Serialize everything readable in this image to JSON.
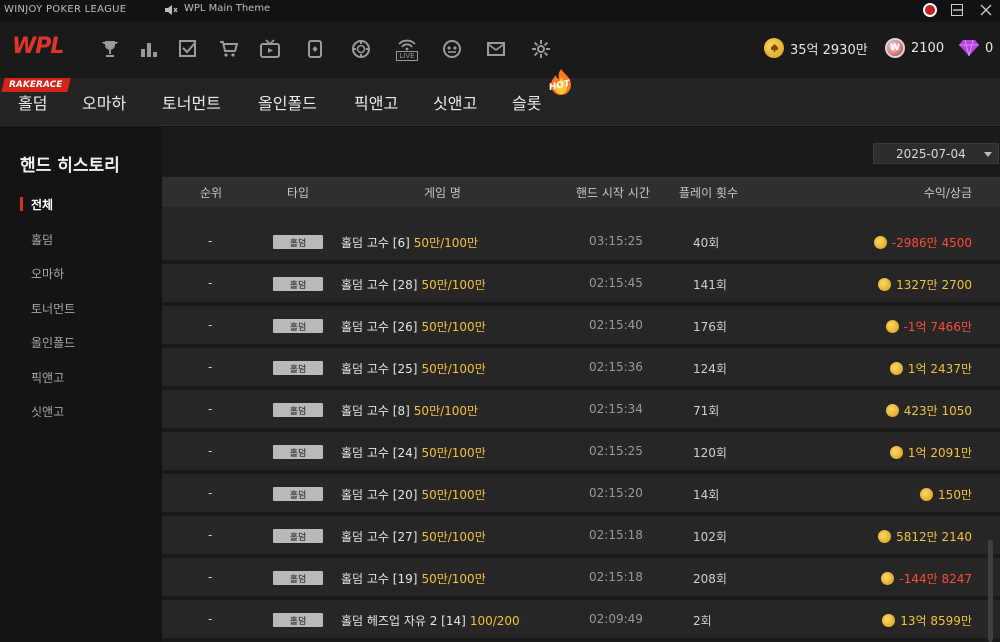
{
  "window": {
    "app_title": "WINJOY POKER LEAGUE",
    "now_playing": "WPL Main Theme"
  },
  "topnav": {
    "logo": "WPL",
    "icons": [
      "trophy-icon",
      "ranking-icon",
      "mission-icon",
      "shop-icon",
      "tv-icon",
      "cards-icon",
      "chip-icon",
      "live-icon",
      "face-icon",
      "mail-icon",
      "settings-icon"
    ],
    "live_label": "LIVE",
    "gold": "35억 2930만",
    "points": "2100",
    "gems": "0",
    "points_badge": "W"
  },
  "gametabs": {
    "rakerace_badge": "RAKERACE",
    "hot_badge": "HOT",
    "tabs": [
      "홀덤",
      "오마하",
      "토너먼트",
      "올인폴드",
      "픽앤고",
      "싯앤고",
      "슬롯"
    ]
  },
  "sidebar": {
    "title": "핸드 히스토리",
    "items": [
      "전체",
      "홀덤",
      "오마하",
      "토너먼트",
      "올인폴드",
      "픽앤고",
      "싯앤고"
    ]
  },
  "main": {
    "date": "2025-07-04",
    "columns": [
      "순위",
      "타입",
      "게임 명",
      "핸드 시작 시간",
      "플레이 횟수",
      "수익/상금"
    ],
    "rows": [
      {
        "rank": "-",
        "type": "홀덤",
        "name": "홀덤 고수 [6]",
        "stake": "50만/100만",
        "time": "03:15:25",
        "count": "40회",
        "profit": "-2986만 4500",
        "negative": true
      },
      {
        "rank": "-",
        "type": "홀덤",
        "name": "홀덤 고수 [28]",
        "stake": "50만/100만",
        "time": "02:15:45",
        "count": "141회",
        "profit": "1327만 2700",
        "negative": false
      },
      {
        "rank": "-",
        "type": "홀덤",
        "name": "홀덤 고수 [26]",
        "stake": "50만/100만",
        "time": "02:15:40",
        "count": "176회",
        "profit": "-1억 7466만",
        "negative": true
      },
      {
        "rank": "-",
        "type": "홀덤",
        "name": "홀덤 고수 [25]",
        "stake": "50만/100만",
        "time": "02:15:36",
        "count": "124회",
        "profit": "1억 2437만",
        "negative": false
      },
      {
        "rank": "-",
        "type": "홀덤",
        "name": "홀덤 고수 [8]",
        "stake": "50만/100만",
        "time": "02:15:34",
        "count": "71회",
        "profit": "423만 1050",
        "negative": false
      },
      {
        "rank": "-",
        "type": "홀덤",
        "name": "홀덤 고수 [24]",
        "stake": "50만/100만",
        "time": "02:15:25",
        "count": "120회",
        "profit": "1억 2091만",
        "negative": false
      },
      {
        "rank": "-",
        "type": "홀덤",
        "name": "홀덤 고수 [20]",
        "stake": "50만/100만",
        "time": "02:15:20",
        "count": "14회",
        "profit": "150만",
        "negative": false
      },
      {
        "rank": "-",
        "type": "홀덤",
        "name": "홀덤 고수 [27]",
        "stake": "50만/100만",
        "time": "02:15:18",
        "count": "102회",
        "profit": "5812만 2140",
        "negative": false
      },
      {
        "rank": "-",
        "type": "홀덤",
        "name": "홀덤 고수 [19]",
        "stake": "50만/100만",
        "time": "02:15:18",
        "count": "208회",
        "profit": "-144만 8247",
        "negative": true
      },
      {
        "rank": "-",
        "type": "홀덤",
        "name": "홀덤 헤즈업 자유 2 [14]",
        "stake": "100/200",
        "time": "02:09:49",
        "count": "2회",
        "profit": "13억 8599만",
        "negative": false
      }
    ]
  },
  "colors": {
    "accent_red": "#d8322a",
    "gold": "#f0c43a",
    "negative": "#ff4b3b"
  }
}
